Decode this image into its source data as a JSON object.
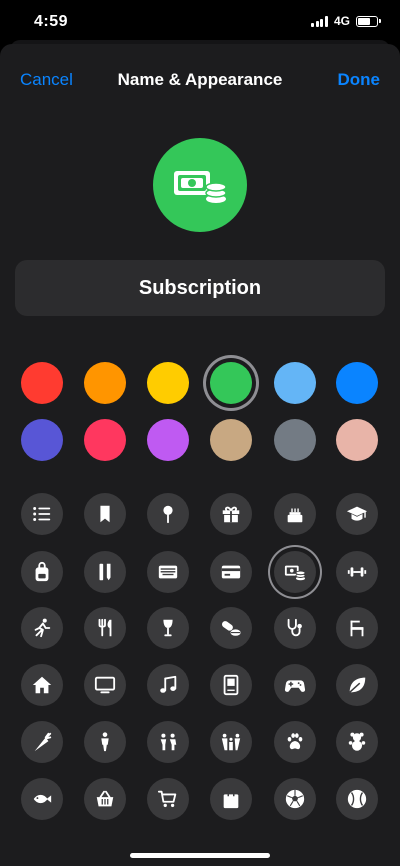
{
  "status_bar": {
    "time": "4:59",
    "network": "4G",
    "battery_level": 0.7
  },
  "nav": {
    "cancel_label": "Cancel",
    "title": "Name & Appearance",
    "done_label": "Done"
  },
  "list": {
    "name": "Subscription",
    "selected_color": "#34c759",
    "selected_icon": "money-icon"
  },
  "colors": [
    {
      "name": "red",
      "hex": "#ff3b30"
    },
    {
      "name": "orange",
      "hex": "#ff9500"
    },
    {
      "name": "yellow",
      "hex": "#ffcc00"
    },
    {
      "name": "green",
      "hex": "#34c759",
      "selected": true
    },
    {
      "name": "light-blue",
      "hex": "#64b5f6"
    },
    {
      "name": "blue",
      "hex": "#0a84ff"
    },
    {
      "name": "indigo",
      "hex": "#5856d6"
    },
    {
      "name": "pink",
      "hex": "#ff375f"
    },
    {
      "name": "purple",
      "hex": "#bf5af2"
    },
    {
      "name": "beige",
      "hex": "#c8a882"
    },
    {
      "name": "gray",
      "hex": "#737b84"
    },
    {
      "name": "rose",
      "hex": "#e8b4a8"
    }
  ],
  "icons": [
    "list-icon",
    "bookmark-icon",
    "pin-icon",
    "gift-icon",
    "cake-icon",
    "graduation-cap-icon",
    "backpack-icon",
    "ruler-pencil-icon",
    "keyboard-icon",
    "credit-card-icon",
    "money-icon",
    "dumbbell-icon",
    "running-icon",
    "fork-knife-icon",
    "wine-glass-icon",
    "pills-icon",
    "stethoscope-icon",
    "chair-icon",
    "house-icon",
    "tv-icon",
    "music-note-icon",
    "computer-icon",
    "gamepad-icon",
    "leaf-icon",
    "carrot-icon",
    "person-icon",
    "two-people-icon",
    "family-icon",
    "paw-icon",
    "teddy-bear-icon",
    "fish-icon",
    "basket-icon",
    "cart-icon",
    "shopping-bag-icon",
    "soccer-ball-icon",
    "baseball-icon"
  ]
}
